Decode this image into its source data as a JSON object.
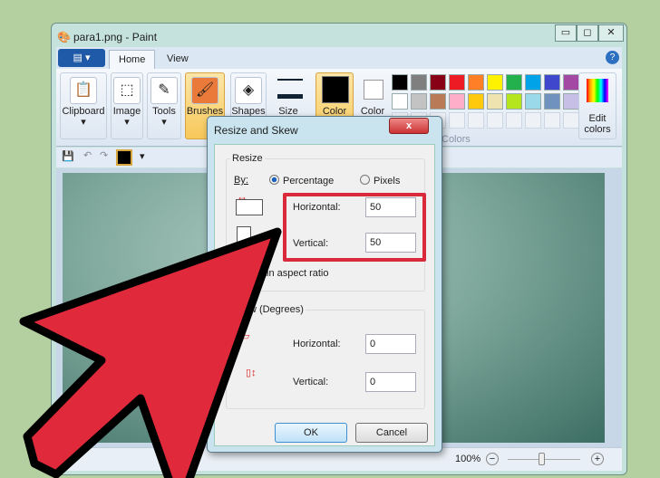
{
  "window": {
    "title": "para1.png - Paint",
    "minimize": "▭",
    "maximize": "◻",
    "close": "✕"
  },
  "tabs": [
    {
      "label": "Home"
    },
    {
      "label": "View"
    }
  ],
  "ribbon": {
    "groups": [
      "Clipboard",
      "Image",
      "Tools",
      "Brushes",
      "Shapes",
      "Size"
    ],
    "color1": "Color",
    "color2": "Color",
    "colors_label": "Colors",
    "edit_colors": "Edit colors",
    "help": "?"
  },
  "palette": [
    "#000000",
    "#7f7f7f",
    "#880015",
    "#ed1c24",
    "#ff7f27",
    "#fff200",
    "#22b14c",
    "#00a2e8",
    "#3f48cc",
    "#a349a4",
    "#ffffff",
    "#c3c3c3",
    "#b97a57",
    "#ffaec9",
    "#ffc90e",
    "#efe4b0",
    "#b5e61d",
    "#99d9ea",
    "#7092be",
    "#c8bfe7"
  ],
  "status": {
    "zoom": "100%"
  },
  "dialog": {
    "title": "Resize and Skew",
    "resize_label": "Resize",
    "by": "By:",
    "percentage": "Percentage",
    "pixels": "Pixels",
    "horizontal_label": "Horizontal:",
    "horizontal_value": "50",
    "vertical_label": "Vertical:",
    "vertical_value": "50",
    "aspect": "Maintain aspect ratio",
    "skew_label": "Skew (Degrees)",
    "skew_h_label": "Horizontal:",
    "skew_h_value": "0",
    "skew_v_label": "Vertical:",
    "skew_v_value": "0",
    "ok": "OK",
    "cancel": "Cancel"
  },
  "colors": {
    "highlight": "#d9293b",
    "arrow": "#e02a3c"
  }
}
